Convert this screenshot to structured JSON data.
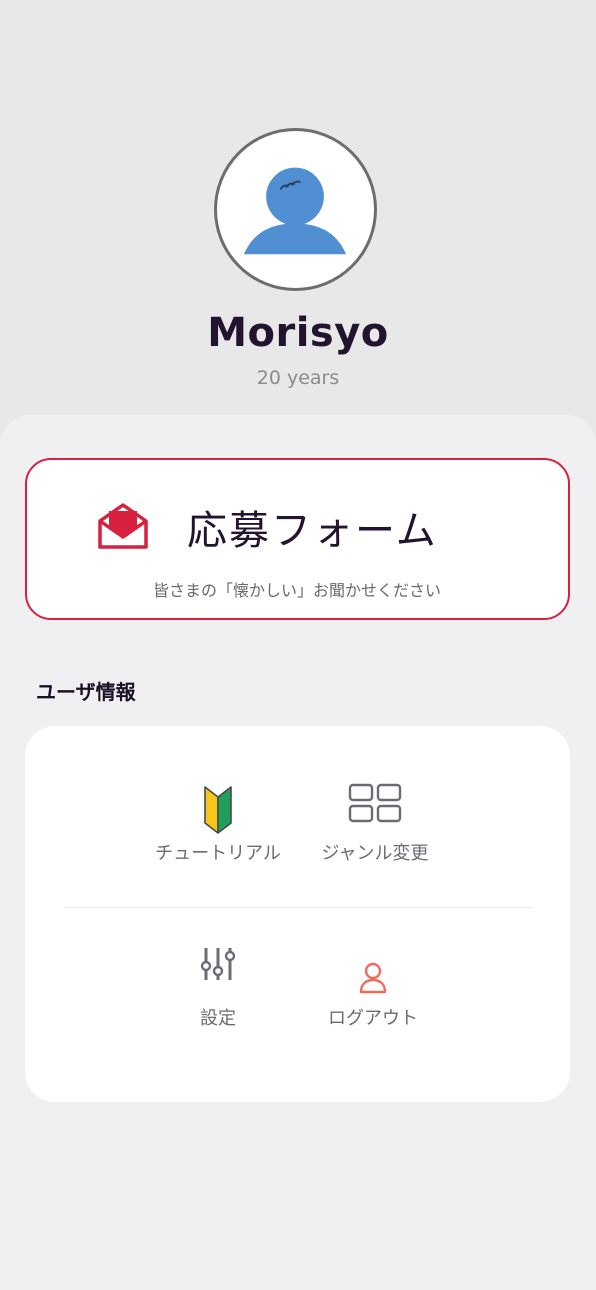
{
  "profile": {
    "name": "Morisyo",
    "age": "20 years"
  },
  "apply_form": {
    "title": "応募フォーム",
    "subtitle": "皆さまの「懐かしい」お聞かせください",
    "icon": "open-envelope-icon",
    "accent_color": "#d7213f"
  },
  "user_info": {
    "section_title": "ユーザ情報",
    "items": [
      {
        "label": "チュートリアル",
        "icon": "beginner-mark-icon"
      },
      {
        "label": "ジャンル変更",
        "icon": "grid-icon"
      },
      {
        "label": "設定",
        "icon": "sliders-icon"
      },
      {
        "label": "ログアウト",
        "icon": "user-outline-icon"
      }
    ]
  }
}
